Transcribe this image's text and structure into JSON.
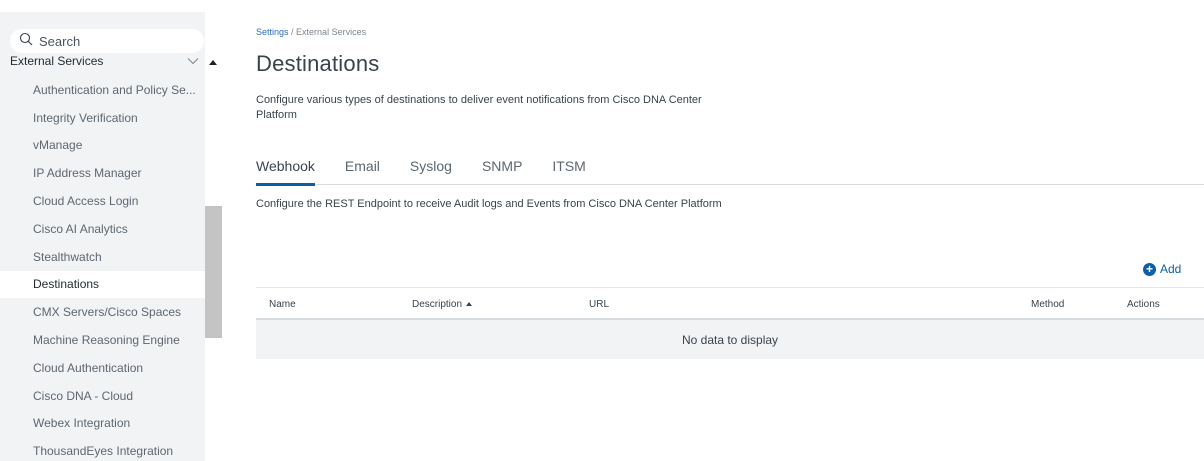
{
  "sidebar": {
    "search_placeholder": "Search",
    "section_title": "External Services",
    "items": [
      {
        "label": "Authentication and Policy Se..."
      },
      {
        "label": "Integrity Verification"
      },
      {
        "label": "vManage"
      },
      {
        "label": "IP Address Manager"
      },
      {
        "label": "Cloud Access Login"
      },
      {
        "label": "Cisco AI Analytics"
      },
      {
        "label": "Stealthwatch"
      },
      {
        "label": "Destinations",
        "active": true
      },
      {
        "label": "CMX Servers/Cisco Spaces"
      },
      {
        "label": "Machine Reasoning Engine"
      },
      {
        "label": "Cloud Authentication"
      },
      {
        "label": "Cisco DNA - Cloud"
      },
      {
        "label": "Webex Integration"
      },
      {
        "label": "ThousandEyes Integration"
      }
    ]
  },
  "breadcrumb": {
    "root": "Settings",
    "separator": " / ",
    "current": "External Services"
  },
  "page": {
    "title": "Destinations",
    "description": "Configure various types of destinations to deliver event notifications from Cisco DNA Center Platform"
  },
  "tabs": [
    {
      "label": "Webhook",
      "active": true
    },
    {
      "label": "Email"
    },
    {
      "label": "Syslog"
    },
    {
      "label": "SNMP"
    },
    {
      "label": "ITSM"
    }
  ],
  "webhook": {
    "description": "Configure the REST Endpoint to receive Audit logs and Events from Cisco DNA Center Platform",
    "add_label": "Add",
    "table": {
      "columns": {
        "name": "Name",
        "description": "Description",
        "url": "URL",
        "method": "Method",
        "actions": "Actions"
      },
      "sorted_column": "Description",
      "empty_message": "No data to display"
    }
  },
  "colors": {
    "accent": "#0a60a8",
    "link": "#2a6ebb",
    "sidebar_bg": "#f2f3f5"
  },
  "icons": {
    "search": "search-icon",
    "collapse": "chevron-down-icon",
    "add": "plus-circle-icon",
    "sort": "sort-ascending-icon"
  }
}
